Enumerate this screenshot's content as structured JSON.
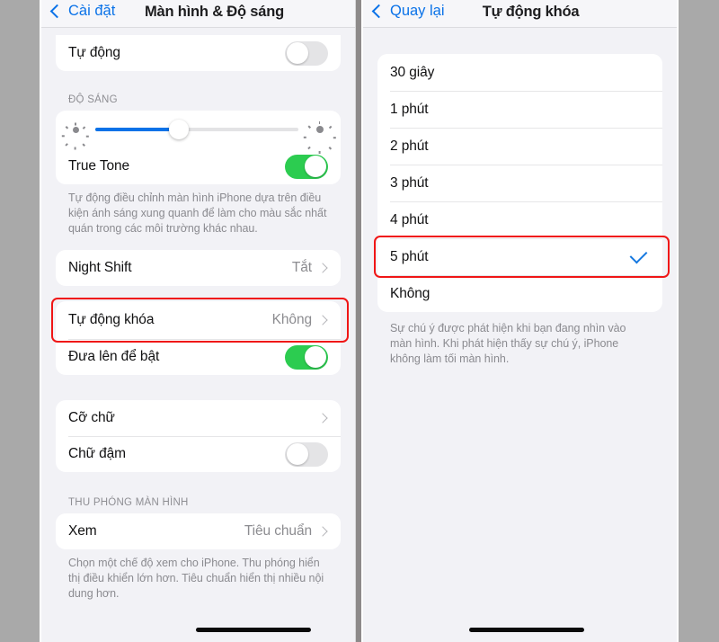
{
  "left_screen": {
    "nav": {
      "back_label": "Cài đặt",
      "title": "Màn hình & Độ sáng",
      "back_icon": "chevron-left-icon"
    },
    "auto_row": {
      "label": "Tự động",
      "toggle": "off"
    },
    "brightness": {
      "section_header": "ĐỘ SÁNG",
      "value_percent": 41,
      "low_icon": "sun-small-icon",
      "high_icon": "sun-large-icon"
    },
    "true_tone": {
      "label": "True Tone",
      "toggle": "on"
    },
    "true_tone_footer": "Tự động điều chỉnh màn hình iPhone dựa trên điều kiện ánh sáng xung quanh để làm cho màu sắc nhất quán trong các môi trường khác nhau.",
    "night_shift": {
      "label": "Night Shift",
      "value": "Tắt",
      "chevron": "chevron-right-icon"
    },
    "auto_lock": {
      "label": "Tự động khóa",
      "value": "Không",
      "chevron": "chevron-right-icon",
      "highlighted": true
    },
    "raise_to_wake": {
      "label": "Đưa lên để bật",
      "toggle": "on"
    },
    "text_size": {
      "label": "Cỡ chữ",
      "chevron": "chevron-right-icon"
    },
    "bold_text": {
      "label": "Chữ đậm",
      "toggle": "off"
    },
    "display_zoom": {
      "section_header": "THU PHÓNG MÀN HÌNH",
      "view": {
        "label": "Xem",
        "value": "Tiêu chuẩn",
        "chevron": "chevron-right-icon"
      },
      "footer": "Chọn một chế độ xem cho iPhone. Thu phóng hiển thị điều khiển lớn hơn. Tiêu chuẩn hiển thị nhiều nội dung hơn."
    }
  },
  "right_screen": {
    "nav": {
      "back_label": "Quay lại",
      "title": "Tự động khóa",
      "back_icon": "chevron-left-icon"
    },
    "options": [
      {
        "label": "30 giây",
        "selected": false,
        "highlighted": false
      },
      {
        "label": "1 phút",
        "selected": false,
        "highlighted": false
      },
      {
        "label": "2 phút",
        "selected": false,
        "highlighted": false
      },
      {
        "label": "3 phút",
        "selected": false,
        "highlighted": false
      },
      {
        "label": "4 phút",
        "selected": false,
        "highlighted": false
      },
      {
        "label": "5 phút",
        "selected": true,
        "highlighted": true
      },
      {
        "label": "Không",
        "selected": false,
        "highlighted": false
      }
    ],
    "footer": "Sự chú ý được phát hiện khi bạn đang nhìn vào màn hình. Khi phát hiện thấy sự chú ý, iPhone không làm tối màn hình."
  },
  "colors": {
    "accent_blue": "#0a72e8",
    "toggle_green": "#2ccc50",
    "highlight_red": "#f01616",
    "screen_bg": "#f2f2f6",
    "page_bg": "#a9a9a9"
  }
}
